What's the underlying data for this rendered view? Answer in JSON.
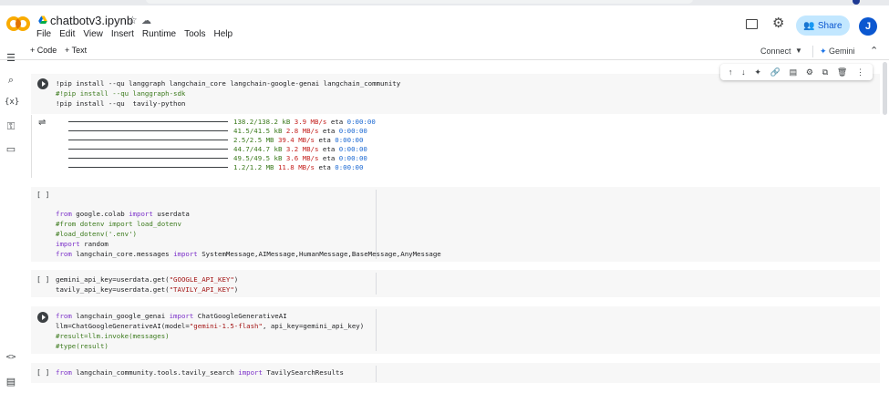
{
  "notebook": {
    "title": "chatbotv3.ipynb",
    "menu": [
      "File",
      "Edit",
      "View",
      "Insert",
      "Runtime",
      "Tools",
      "Help"
    ],
    "share_label": "Share",
    "avatar_initial": "J"
  },
  "toolbar": {
    "code_label": "+ Code",
    "text_label": "+ Text",
    "connect_label": "Connect",
    "gemini_label": "Gemini"
  },
  "cells": {
    "c1": {
      "l1": "!pip install --qu langgraph langchain_core langchain-google-genai langchain_community",
      "l2": "#!pip install --qu langgraph-sdk",
      "l3": "!pip install --qu  tavily-python"
    },
    "output": [
      {
        "size": "138.2/138.2 kB",
        "speed": "3.9 MB/s",
        "eta": "0:00:00"
      },
      {
        "size": "41.5/41.5 kB",
        "speed": "2.8 MB/s",
        "eta": "0:00:00"
      },
      {
        "size": "2.5/2.5 MB",
        "speed": "39.4 MB/s",
        "eta": "0:00:00"
      },
      {
        "size": "44.7/44.7 kB",
        "speed": "3.2 MB/s",
        "eta": "0:00:00"
      },
      {
        "size": "49.5/49.5 kB",
        "speed": "3.6 MB/s",
        "eta": "0:00:00"
      },
      {
        "size": "1.2/1.2 MB",
        "speed": "11.8 MB/s",
        "eta": "0:00:00"
      }
    ],
    "eta_label": "eta",
    "bracket": "[ ]",
    "c2": {
      "l1a": "from",
      "l1b": " google.colab ",
      "l1c": "import",
      "l1d": " userdata",
      "l2": "#from dotenv import load_dotenv",
      "l3": "#load_dotenv('.env')",
      "l4a": "import",
      "l4b": " random",
      "l5a": "from",
      "l5b": " langchain_core.messages ",
      "l5c": "import",
      "l5d": " SystemMessage,AIMessage,HumanMessage,BaseMessage,AnyMessage"
    },
    "c3": {
      "l1a": "gemini_api_key=userdata.get(",
      "l1b": "\"GOOGLE_API_KEY\"",
      "l1c": ")",
      "l2a": "tavily_api_key=userdata.get(",
      "l2b": "\"TAVILY_API_KEY\"",
      "l2c": ")"
    },
    "c4": {
      "l1a": "from",
      "l1b": " langchain_google_genai ",
      "l1c": "import",
      "l1d": " ChatGoogleGenerativeAI",
      "l2a": "llm=ChatGoogleGenerativeAI(model=",
      "l2b": "\"gemini-1.5-flash\"",
      "l2c": ", api_key=gemini_api_key)",
      "l3": "#result=llm.invoke(messages)",
      "l4": "#type(result)"
    },
    "c5": {
      "l1a": "from",
      "l1b": " langchain_community.tools.tavily_search ",
      "l1c": "import",
      "l1d": " TavilySearchResults"
    }
  }
}
